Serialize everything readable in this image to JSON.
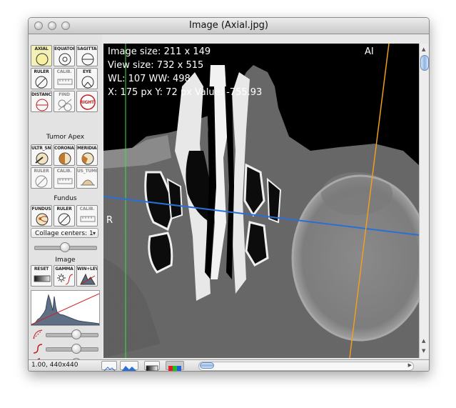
{
  "window": {
    "title": "Image (Axial.jpg)"
  },
  "tools": {
    "axial": "AXIAL",
    "equator": "EQUATOR",
    "sagittal": "SAGITTAL",
    "ruler": "RULER",
    "calib": "CALIB.",
    "eye": "EYE",
    "distance": "DISTANCE",
    "find": "FIND",
    "right": "RIGHT",
    "ultr_snd": "ULTR_SND",
    "coronal": "CORONAL",
    "meridian": "MERIDIAN",
    "ruler2": "RULER",
    "calib2": "CALIB.",
    "us_tumor": "US_TUMOR",
    "fundus": "FUNDUS",
    "ruler3": "RULER",
    "calib3": "CALIB.",
    "reset": "RESET",
    "gamma": "GAMMA",
    "win_lev": "WIN+LEV"
  },
  "sections": {
    "tumor_apex": "Tumor Apex",
    "fundus": "Fundus",
    "image": "Image"
  },
  "collage": {
    "selected": "Collage centers: 1"
  },
  "sliders": {
    "collage_level": 0.5,
    "curve1": 0.6,
    "curve2": 0.6,
    "curve3": 0.6
  },
  "overlay": {
    "image_size": "Image size: 211 x 149",
    "view_size": "View size: 732 x 515",
    "wl_ww": "WL: 107 WW: 498",
    "cursor": "X: 175 px Y: 72 px Value: -755.93",
    "orientation_ai": "AI",
    "orientation_r": "R"
  },
  "status": {
    "zoom_text": "1.00, 440x440"
  },
  "colors": {
    "blue_line": "#2a6fd6",
    "orange_line": "#f0a020",
    "green_line": "#3ee03e"
  }
}
